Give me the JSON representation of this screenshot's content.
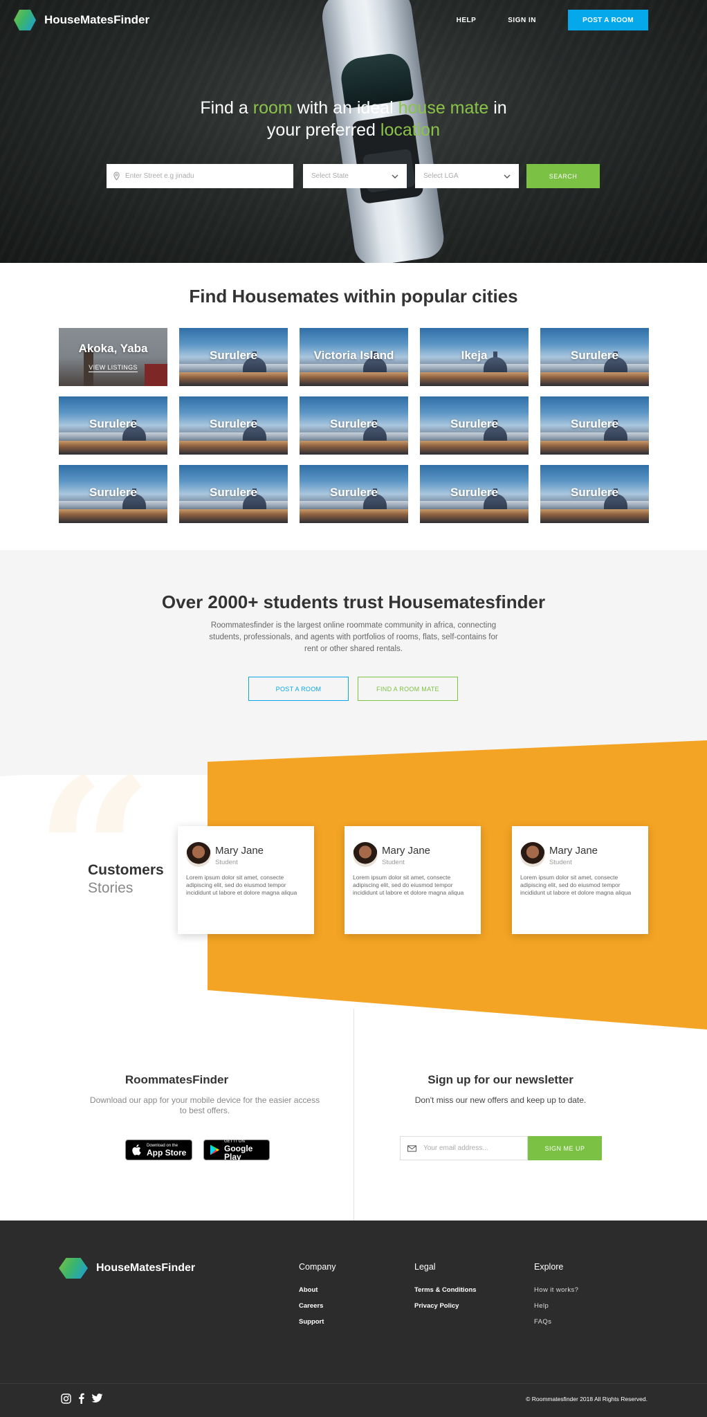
{
  "brand": {
    "name": "HouseMatesFinder",
    "logo_colors": [
      "#7bc143",
      "#1a9ce0"
    ]
  },
  "nav": {
    "help": "HELP",
    "sign_in": "SIGN IN",
    "post_room": "POST A ROOM"
  },
  "hero": {
    "title_parts": [
      "Find a ",
      "room",
      " with an ideal ",
      "house mate",
      " in",
      "your preferred ",
      "location"
    ],
    "street_placeholder": "Enter Street e.g jinadu",
    "state_placeholder": "Select State",
    "lga_placeholder": "Select LGA",
    "search_label": "SEARCH"
  },
  "cities": {
    "title": "Find Housemates within popular cities",
    "featured_action": "VIEW LISTINGS",
    "items": [
      "Akoka, Yaba",
      "Surulere",
      "Victoria Island",
      "Ikeja",
      "Surulere",
      "Surulere",
      "Surulere",
      "Surulere",
      "Surulere",
      "Surulere",
      "Surulere",
      "Surulere",
      "Surulere",
      "Surulere",
      "Surulere"
    ]
  },
  "trust": {
    "title": "Over 2000+ students trust Housematesfinder",
    "text": "Roommatesfinder is the largest online roommate community in africa, connecting students, professionals, and agents with portfolios of rooms, flats, self-contains for rent or other shared rentals.",
    "post_room": "POST A ROOM",
    "find_mate": "FIND A ROOM MATE"
  },
  "stories": {
    "title": "Customers",
    "subtitle": "Stories",
    "accent": "#f4a424",
    "cards": [
      {
        "name": "Mary Jane",
        "role": "Student",
        "text": "Lorem ipsum dolor sit amet, consecte adipiscing elit, sed do eiusmod tempor incididunt ut labore et dolore magna aliqua"
      },
      {
        "name": "Mary Jane",
        "role": "Student",
        "text": "Lorem ipsum dolor sit amet, consecte adipiscing elit, sed do eiusmod tempor incididunt ut labore et dolore magna aliqua"
      },
      {
        "name": "Mary Jane",
        "role": "Student",
        "text": "Lorem ipsum dolor sit amet, consecte adipiscing elit, sed do eiusmod tempor incididunt ut labore et dolore magna aliqua"
      }
    ]
  },
  "app": {
    "title": "RoommatesFinder",
    "text": "Download our app for your mobile device for the easier access to best offers.",
    "appstore_small": "Download on the",
    "appstore_big": "App Store",
    "google_small": "GET IT ON",
    "google_big": "Google Play"
  },
  "newsletter": {
    "title": "Sign up for our newsletter",
    "text": "Don't miss our new offers and keep up to date.",
    "placeholder": "Your email address...",
    "button": "SIGN ME UP"
  },
  "footer": {
    "company": {
      "heading": "Company",
      "links": [
        "About",
        "Careers",
        "Support"
      ]
    },
    "legal": {
      "heading": "Legal",
      "links": [
        "Terms & Conditions",
        "Privacy Policy"
      ]
    },
    "explore": {
      "heading": "Explore",
      "links": [
        "How it works?",
        "Help",
        "FAQs"
      ]
    },
    "social_icons": [
      "instagram-icon",
      "facebook-icon",
      "twitter-icon"
    ],
    "copyright": "© Roommatesfinder 2018 All Rights Reserved."
  }
}
